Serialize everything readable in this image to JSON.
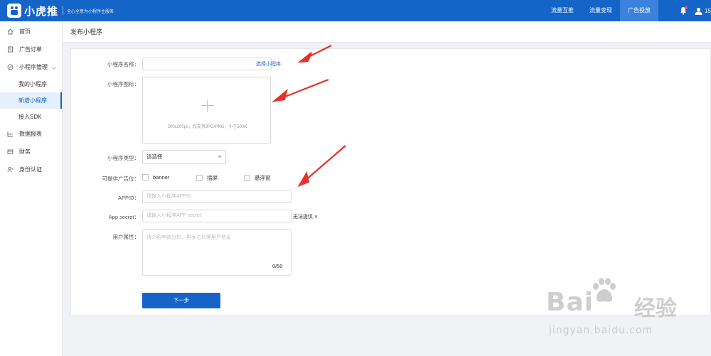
{
  "header": {
    "app_name": "小虎推",
    "slogan": "全心全意为小程序主服务",
    "nav": [
      "流量互推",
      "流量变现",
      "广告投放"
    ],
    "user_label": "15",
    "accent_color": "#1564c8"
  },
  "sidebar": {
    "items": [
      {
        "label": "首页",
        "icon": "home-icon"
      },
      {
        "label": "广告订单",
        "icon": "order-icon"
      },
      {
        "label": "小程序管理",
        "icon": "miniprogram-icon"
      },
      {
        "label": "我的小程序"
      },
      {
        "label": "新增小程序"
      },
      {
        "label": "接入SDK"
      },
      {
        "label": "数据报表",
        "icon": "chart-icon"
      },
      {
        "label": "财务",
        "icon": "finance-icon"
      },
      {
        "label": "身份认证",
        "icon": "id-icon"
      }
    ],
    "active_item": "新增小程序"
  },
  "page": {
    "title": "发布小程序"
  },
  "form": {
    "name_label": "小程序名称：",
    "name_link": "选择小程序",
    "icon_label": "小程序图标：",
    "icon_hint": "200x200px，仅支持JPG/PNG，小于500K",
    "type_label": "小程序类型：",
    "type_value": "请选择",
    "ad_slot_label": "可提供广告位：",
    "ad_slots": [
      "banner",
      "插屏",
      "悬浮窗"
    ],
    "appid_label": "APPID：",
    "appid_placeholder": "请输入小程序APPID",
    "secret_label": "App secret：",
    "secret_placeholder": "请输入小程序APP secret",
    "secret_extra": "无法提供 ∨",
    "attr_label": "用户属性：",
    "attr_placeholder": "请介绍年龄分布、男女占比等用户信息",
    "attr_counter": "0/50",
    "next_button": "下一步"
  },
  "watermark": {
    "brand": "Bai",
    "brand_cn": "经验",
    "url": "jingyan.baidu.com"
  }
}
